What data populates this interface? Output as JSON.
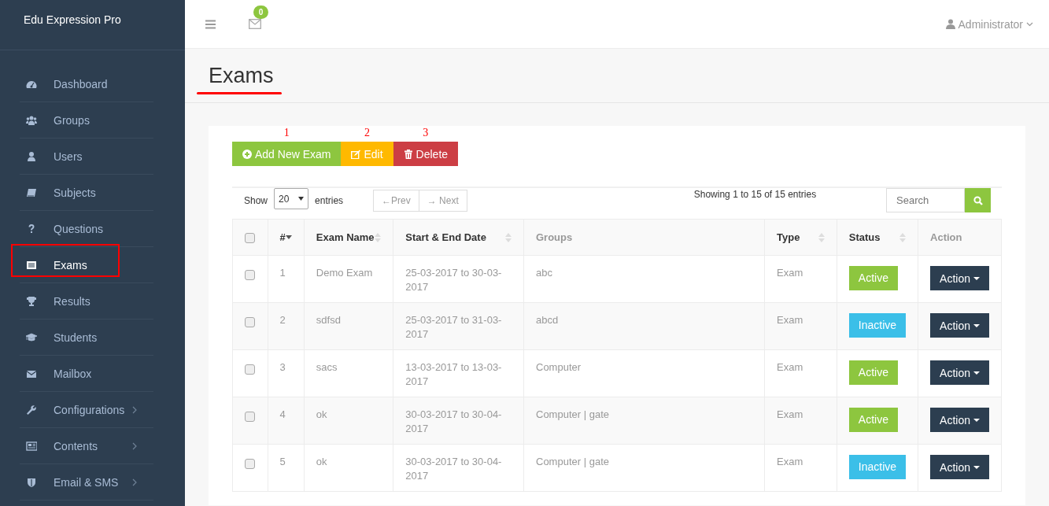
{
  "app": {
    "brand": "Edu Expression Pro"
  },
  "sidebar": {
    "items": [
      {
        "label": "Dashboard",
        "selected": false,
        "has_submenu": false,
        "annotated": false
      },
      {
        "label": "Groups",
        "selected": false,
        "has_submenu": false,
        "annotated": false
      },
      {
        "label": "Users",
        "selected": false,
        "has_submenu": false,
        "annotated": false
      },
      {
        "label": "Subjects",
        "selected": false,
        "has_submenu": false,
        "annotated": false
      },
      {
        "label": "Questions",
        "selected": false,
        "has_submenu": false,
        "annotated": false
      },
      {
        "label": "Exams",
        "selected": true,
        "has_submenu": false,
        "annotated": true
      },
      {
        "label": "Results",
        "selected": false,
        "has_submenu": false,
        "annotated": false
      },
      {
        "label": "Students",
        "selected": false,
        "has_submenu": false,
        "annotated": false
      },
      {
        "label": "Mailbox",
        "selected": false,
        "has_submenu": false,
        "annotated": false
      },
      {
        "label": "Configurations",
        "selected": false,
        "has_submenu": true,
        "annotated": false
      },
      {
        "label": "Contents",
        "selected": false,
        "has_submenu": true,
        "annotated": false
      },
      {
        "label": "Email & SMS",
        "selected": false,
        "has_submenu": true,
        "annotated": false
      }
    ]
  },
  "topbar": {
    "mail_count": "0",
    "user": "Administrator"
  },
  "page": {
    "title": "Exams",
    "title_annotated": true
  },
  "toolbar": {
    "buttons": [
      {
        "label": "Add New Exam",
        "kind": "add",
        "annotation": "1"
      },
      {
        "label": "Edit",
        "kind": "edit",
        "annotation": "2"
      },
      {
        "label": "Delete",
        "kind": "delete",
        "annotation": "3"
      }
    ]
  },
  "list_controls": {
    "show_label": "Show",
    "page_size": "20",
    "entries_label": "entries",
    "prev": "←Prev",
    "next": "→ Next",
    "info": "Showing 1 to 15 of 15 entries",
    "search": {
      "placeholder": "Search"
    }
  },
  "table": {
    "select_all_checked": false,
    "columns": [
      {
        "label": "#",
        "sortable": true,
        "sorted": true
      },
      {
        "label": "Exam Name",
        "sortable": true,
        "sorted": false
      },
      {
        "label": "Start & End Date",
        "sortable": true,
        "sorted": false
      },
      {
        "label": "Groups",
        "sortable": false
      },
      {
        "label": "Type",
        "sortable": true,
        "sorted": false
      },
      {
        "label": "Status",
        "sortable": true,
        "sorted": false
      },
      {
        "label": "Action",
        "sortable": false
      }
    ],
    "rows": [
      {
        "checked": false,
        "number": "1",
        "name": "Demo Exam",
        "dates": "25-03-2017 to 30-03-2017",
        "groups": "abc",
        "type": "Exam",
        "status": {
          "label": "Active",
          "active": true
        },
        "action": "Action"
      },
      {
        "checked": false,
        "number": "2",
        "name": "sdfsd",
        "dates": "25-03-2017 to 31-03-2017",
        "groups": "abcd",
        "type": "Exam",
        "status": {
          "label": "Inactive",
          "active": false
        },
        "action": "Action"
      },
      {
        "checked": false,
        "number": "3",
        "name": "sacs",
        "dates": "13-03-2017 to 13-03-2017",
        "groups": "Computer",
        "type": "Exam",
        "status": {
          "label": "Active",
          "active": true
        },
        "action": "Action"
      },
      {
        "checked": false,
        "number": "4",
        "name": "ok",
        "dates": "30-03-2017 to 30-04-2017",
        "groups": "Computer | gate",
        "type": "Exam",
        "status": {
          "label": "Active",
          "active": true
        },
        "action": "Action"
      },
      {
        "checked": false,
        "number": "5",
        "name": "ok",
        "dates": "30-03-2017 to 30-04-2017",
        "groups": "Computer | gate",
        "type": "Exam",
        "status": {
          "label": "Inactive",
          "active": false
        },
        "action": "Action"
      }
    ]
  }
}
